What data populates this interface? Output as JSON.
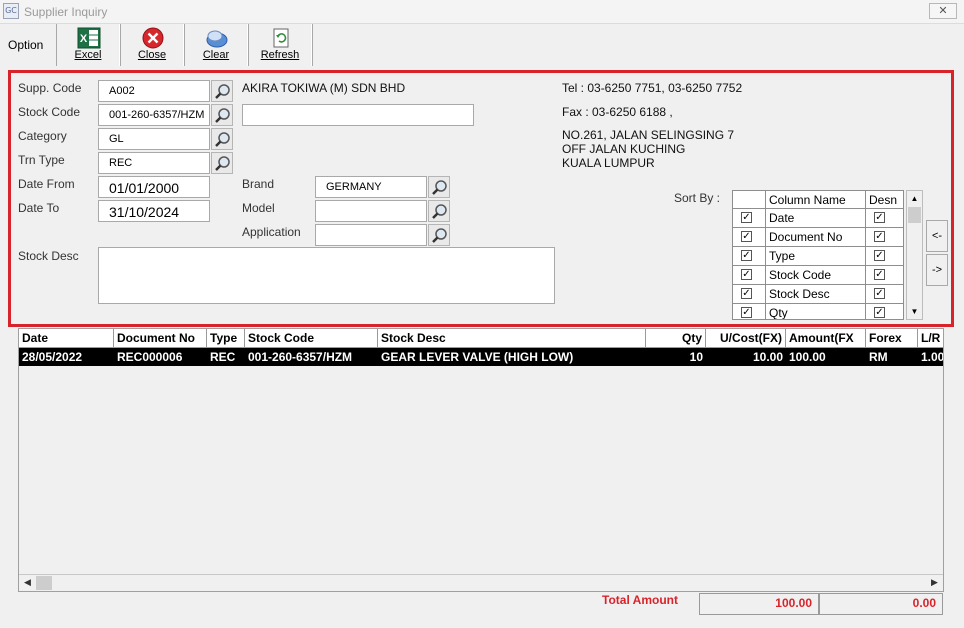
{
  "window": {
    "title": "Supplier Inquiry",
    "app_icon": "GC",
    "close_glyph": "✕"
  },
  "toolbar": {
    "option_label": "Option",
    "buttons": [
      {
        "label": "Excel",
        "icon": "excel-icon"
      },
      {
        "label": "Close",
        "icon": "close-icon"
      },
      {
        "label": "Clear",
        "icon": "clear-icon"
      },
      {
        "label": "Refresh",
        "icon": "refresh-icon"
      }
    ]
  },
  "form": {
    "supp_code": {
      "label": "Supp. Code",
      "value": "A002"
    },
    "stock_code": {
      "label": "Stock Code",
      "value": "001-260-6357/HZM"
    },
    "category": {
      "label": "Category",
      "value": "GL"
    },
    "trn_type": {
      "label": "Trn Type",
      "value": "REC"
    },
    "date_from": {
      "label": "Date From",
      "value": "01/01/2000"
    },
    "date_to": {
      "label": "Date To",
      "value": "31/10/2024"
    },
    "stock_desc": {
      "label": "Stock Desc",
      "value": ""
    },
    "stock_name": {
      "value": ""
    },
    "brand": {
      "label": "Brand",
      "value": "GERMANY"
    },
    "model": {
      "label": "Model",
      "value": ""
    },
    "application": {
      "label": "Application",
      "value": ""
    }
  },
  "supplier": {
    "name": "AKIRA TOKIWA (M) SDN BHD",
    "tel": "Tel : 03-6250 7751, 03-6250 7752",
    "fax": "Fax : 03-6250 6188  ,",
    "address": [
      "NO.261, JALAN SELINGSING 7",
      "OFF JALAN KUCHING",
      "KUALA LUMPUR"
    ]
  },
  "sort": {
    "label": "Sort By :",
    "headers": {
      "column_name": "Column Name",
      "desc": "Desn"
    },
    "rows": [
      {
        "name": "Date",
        "checked": true,
        "desc": true
      },
      {
        "name": "Document No",
        "checked": true,
        "desc": true
      },
      {
        "name": "Type",
        "checked": true,
        "desc": true
      },
      {
        "name": "Stock Code",
        "checked": true,
        "desc": true
      },
      {
        "name": "Stock Desc",
        "checked": true,
        "desc": true
      },
      {
        "name": "Qty",
        "checked": true,
        "desc": true
      }
    ],
    "move_left": "<-",
    "move_right": "->",
    "check_glyph": "✓"
  },
  "results": {
    "columns": [
      "Date",
      "Document No",
      "Type",
      "Stock Code",
      "Stock Desc",
      "Qty",
      "U/Cost(FX)",
      "Amount(FX",
      "Forex",
      "L/R"
    ],
    "rows": [
      {
        "date": "28/05/2022",
        "doc_no": "REC000006",
        "type": "REC",
        "stock_code": "001-260-6357/HZM",
        "stock_desc": "GEAR LEVER VALVE (HIGH LOW)",
        "qty": "10",
        "ucost": "10.00",
        "amount": "100.00",
        "forex": "RM",
        "lr": "1.00"
      }
    ]
  },
  "scroll": {
    "left_arrow": "◀",
    "right_arrow": "▶",
    "up_arrow": "▲",
    "down_arrow": "▼"
  },
  "totals": {
    "label": "Total Amount",
    "amount": "100.00",
    "other": "0.00"
  },
  "colors": {
    "accent_red": "#d9232b",
    "frame_bg": "#f0f0f0"
  }
}
